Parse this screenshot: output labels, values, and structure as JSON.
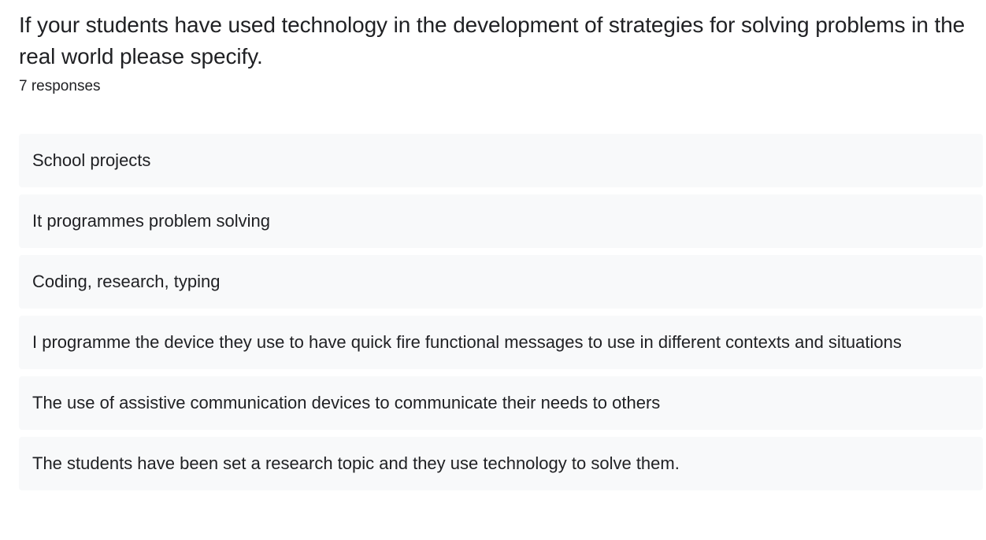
{
  "question": {
    "title": "If your students have used technology in the development of strategies for solving problems in the real world please specify.",
    "response_count": "7 responses"
  },
  "responses": [
    "School projects",
    "It programmes problem solving",
    "Coding, research, typing",
    "I programme the device they use to have quick fire functional messages to use in different contexts and situations",
    "The use of assistive communication devices to communicate their needs to others",
    "The students have been set a research topic and they use technology to solve them."
  ]
}
